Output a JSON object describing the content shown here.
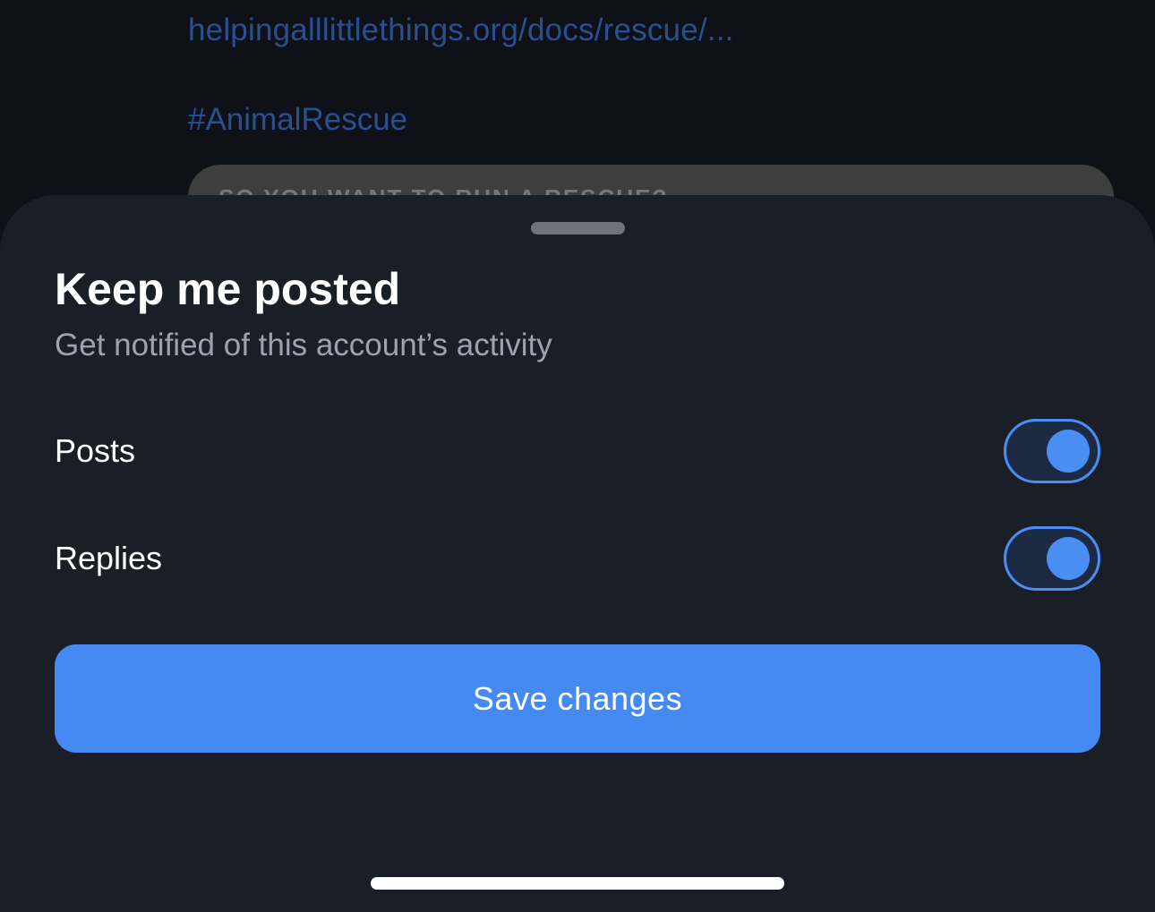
{
  "feed": {
    "link_text": "helpingalllittlethings.org/docs/rescue/...",
    "hashtag": "#AnimalRescue",
    "card_title": "SO YOU WANT TO RUN A RESCUE?"
  },
  "sheet": {
    "title": "Keep me posted",
    "subtitle": "Get notified of this account’s activity",
    "options": [
      {
        "label": "Posts",
        "enabled": true
      },
      {
        "label": "Replies",
        "enabled": true
      }
    ],
    "save_label": "Save changes"
  },
  "colors": {
    "accent": "#4589f2",
    "sheet_background": "#1a1f27",
    "link": "#2a4f8f"
  }
}
